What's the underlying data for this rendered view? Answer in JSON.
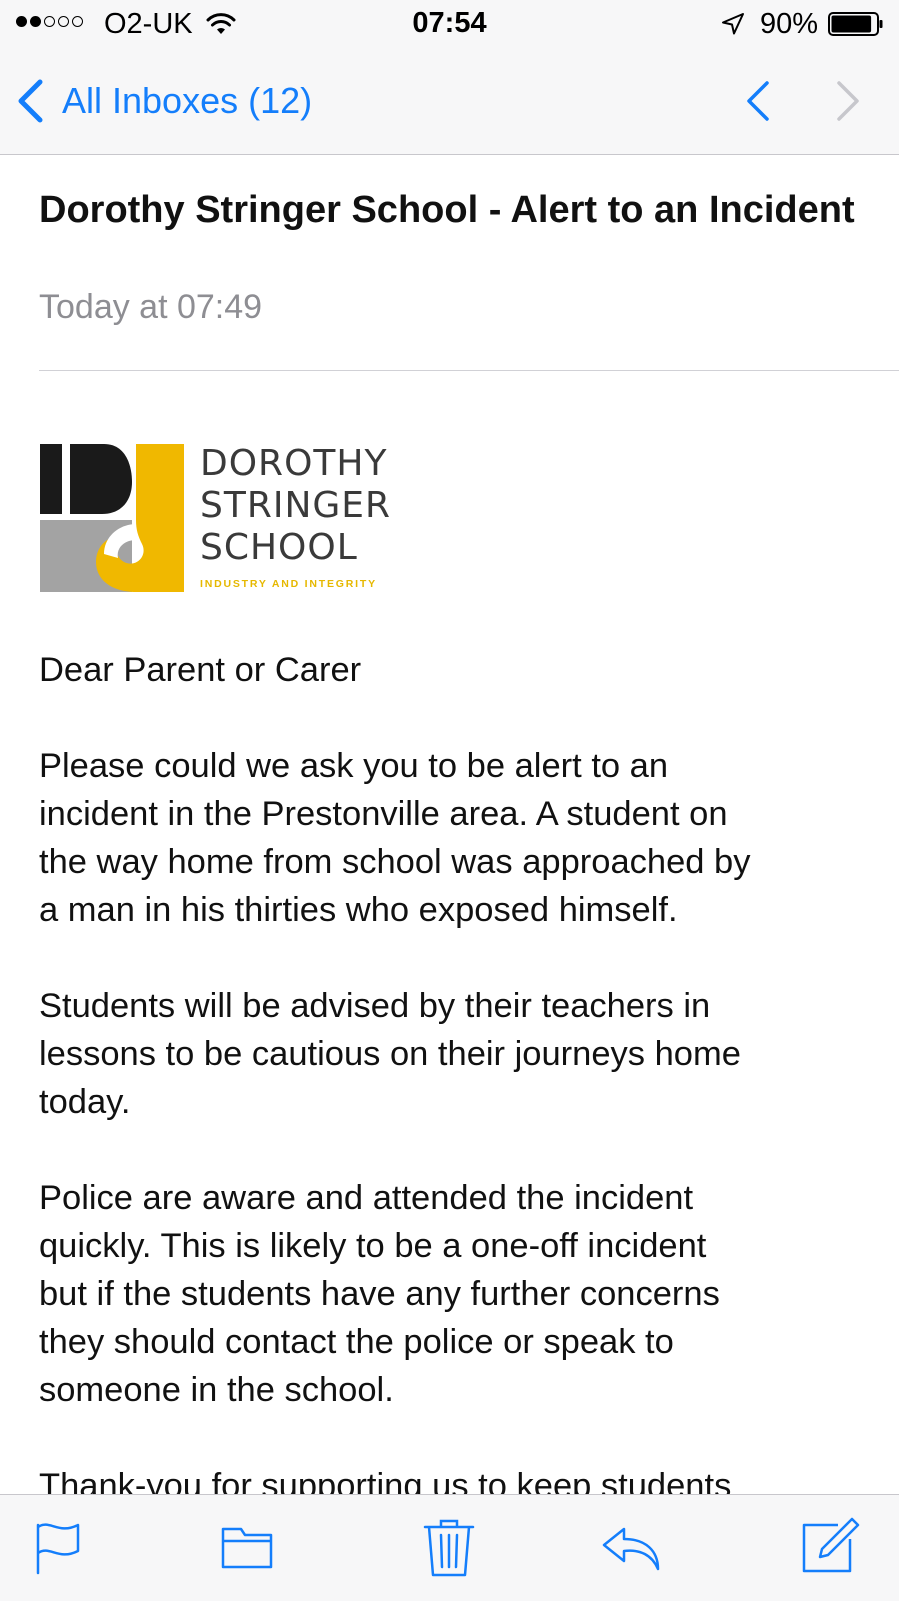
{
  "status_bar": {
    "signal_filled": 2,
    "signal_total": 5,
    "carrier": "O2-UK",
    "time": "07:54",
    "battery_percent": "90%",
    "battery_level": 0.9,
    "icons": [
      "signal-dots-icon",
      "wifi-icon",
      "location-arrow-icon",
      "battery-icon"
    ]
  },
  "nav": {
    "back_label": "All Inboxes (12)",
    "icons": [
      "chevron-left-icon",
      "previous-message-icon",
      "next-message-icon"
    ]
  },
  "message": {
    "subject": "Dorothy Stringer School - Alert to an Incident",
    "date": "Today at 07:49"
  },
  "logo": {
    "name_lines": [
      "DOROTHY",
      "STRINGER",
      "SCHOOL"
    ],
    "tagline": "INDUSTRY AND INTEGRITY"
  },
  "body": {
    "greeting": "Dear Parent or Carer",
    "paragraphs": [
      [
        "Please could we ask you to be alert to an",
        "incident in the Prestonville area. A student on",
        "the way home from school was approached by",
        "a man in his thirties who exposed himself."
      ],
      [
        "Students will be advised by their teachers in",
        "lessons to be cautious on their journeys home",
        "today."
      ],
      [
        "Police are aware and attended the incident",
        "quickly. This is likely to be a one-off incident",
        "but if the students have any further concerns",
        "they should contact the police or speak to",
        "someone in the school."
      ],
      [
        "Thank-you for supporting us to keep students"
      ]
    ]
  },
  "toolbar": {
    "icons": [
      "flag-icon",
      "folder-icon",
      "trash-icon",
      "reply-icon",
      "compose-icon"
    ]
  },
  "colors": {
    "accent": "#147efb",
    "logo_yellow": "#f0b800",
    "logo_grey": "#a3a3a3",
    "logo_dark": "#1a1a1a",
    "secondary_text": "#8e8e93"
  }
}
